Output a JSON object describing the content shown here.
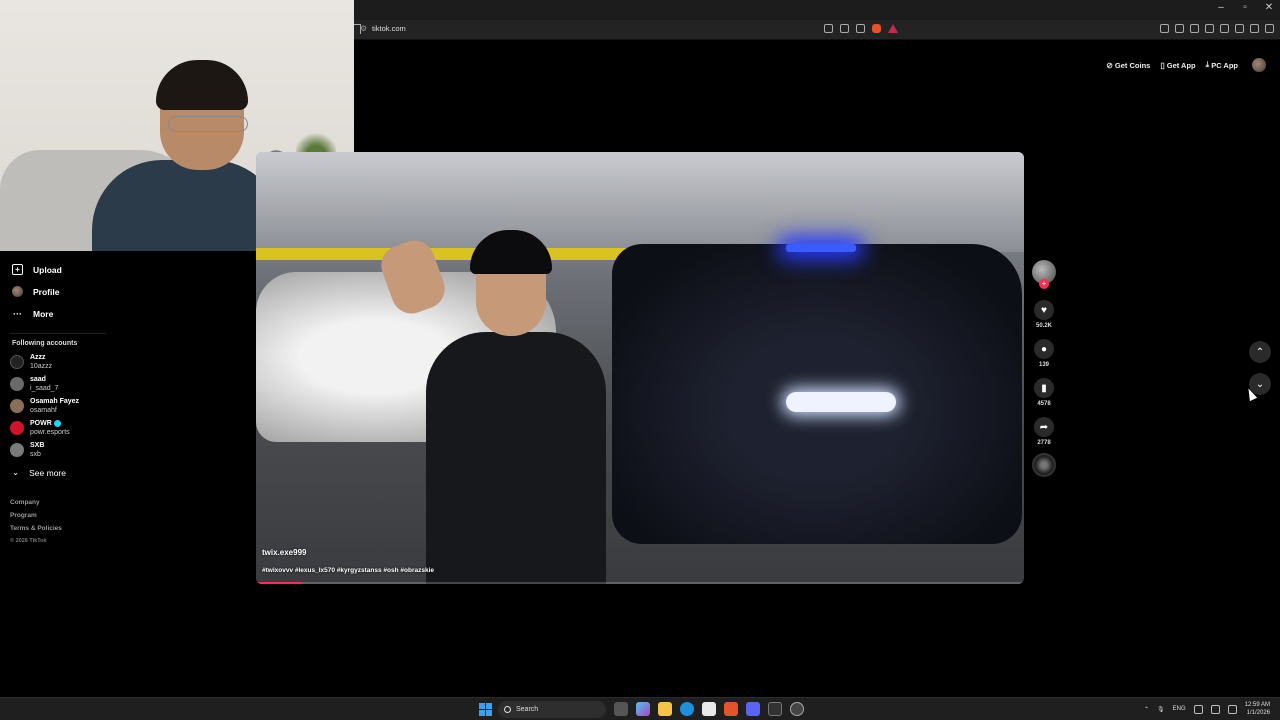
{
  "browser": {
    "url": "tiktok.com",
    "window_controls": [
      "–",
      "▫",
      "✕"
    ]
  },
  "header": {
    "get_coins": "Get Coins",
    "get_app": "Get App",
    "pc_app": "PC App"
  },
  "sidebar": {
    "upload": "Upload",
    "profile": "Profile",
    "more": "More",
    "following_title": "Following accounts",
    "accounts": [
      {
        "name": "Azzz",
        "handle": "10azzz",
        "verified": false
      },
      {
        "name": "saad",
        "handle": "i_saad_7",
        "verified": false
      },
      {
        "name": "Osamah Fayez",
        "handle": "osamahf",
        "verified": false
      },
      {
        "name": "POWR",
        "handle": "powr.esports",
        "verified": true
      },
      {
        "name": "SXB",
        "handle": "sxb",
        "verified": false
      }
    ],
    "see_more": "See more",
    "footer": {
      "company": "Company",
      "program": "Program",
      "terms": "Terms & Policies",
      "copyright": "© 2026 TikTok"
    }
  },
  "video": {
    "author": "twix.exe999",
    "description": "#twixovvv #lexus_lx570 #kyrgyzstanss #osh #obrazskie",
    "progress": 0.06
  },
  "actions": {
    "likes": "50.2K",
    "comments": "139",
    "saves": "4578",
    "shares": "2778"
  },
  "taskbar": {
    "search_placeholder": "Search",
    "language": "ENG",
    "time": "12:59 AM",
    "date": "1/1/2026"
  },
  "colors": {
    "accent": "#fe2c55",
    "verified": "#20d5ec"
  }
}
